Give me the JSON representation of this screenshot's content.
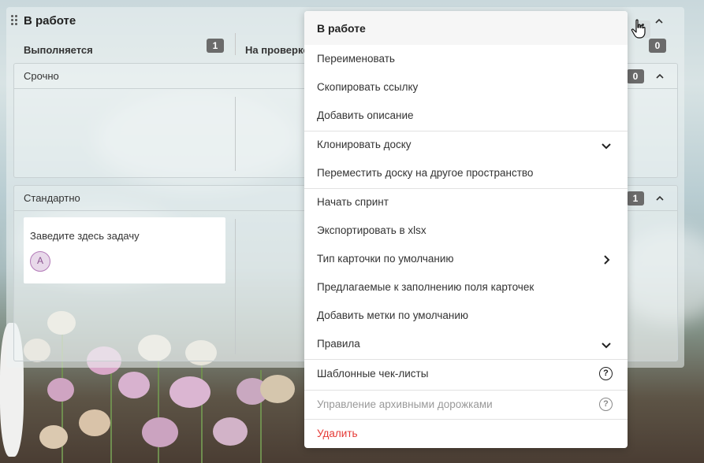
{
  "board": {
    "title": "В работе",
    "columns": [
      {
        "name": "Выполняется",
        "count": "1"
      },
      {
        "name": "На проверке",
        "count": "0"
      }
    ],
    "lanes": [
      {
        "title": "Срочно",
        "count": "0"
      },
      {
        "title": "Стандартно",
        "count": "1"
      }
    ],
    "task": {
      "title": "Заведите здесь задачу",
      "avatar_initial": "А"
    }
  },
  "menu": {
    "title": "В работе",
    "items": [
      {
        "label": "Переименовать"
      },
      {
        "label": "Скопировать ссылку"
      },
      {
        "label": "Добавить описание"
      },
      {
        "label": "Клонировать доску",
        "icon": "chevron-down-icon"
      },
      {
        "label": "Переместить доску на другое пространство"
      },
      {
        "label": "Начать спринт"
      },
      {
        "label": "Экспортировать в xlsx"
      },
      {
        "label": "Тип карточки по умолчанию",
        "icon": "chevron-right-icon"
      },
      {
        "label": "Предлагаемые к заполнению поля карточек"
      },
      {
        "label": "Добавить метки по умолчанию"
      },
      {
        "label": "Правила",
        "icon": "chevron-down-icon"
      },
      {
        "label": "Шаблонные чек-листы",
        "icon": "help-icon",
        "help_glyph": "?"
      },
      {
        "label": "Управление архивными дорожками",
        "icon": "help-icon",
        "help_glyph": "?",
        "disabled": true
      },
      {
        "label": "Удалить",
        "danger": true
      }
    ]
  },
  "colors": {
    "danger": "#e53935",
    "badge": "#6b6b6b",
    "avatar_border": "#b37ab8"
  }
}
